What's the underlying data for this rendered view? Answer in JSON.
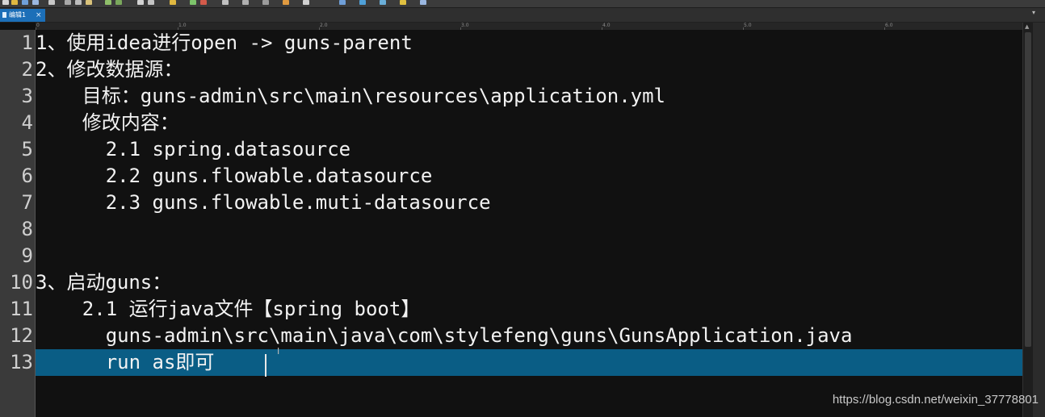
{
  "tab": {
    "title": "编辑1",
    "close": "×"
  },
  "tab_menu_arrow": "▾",
  "ruler": [
    "0",
    "1.0",
    "2.0",
    "3.0",
    "4.0",
    "5.0",
    "6.0"
  ],
  "lines": [
    {
      "no": "1",
      "text": "1、使用idea进行open -> guns-parent"
    },
    {
      "no": "2",
      "text": "2、修改数据源："
    },
    {
      "no": "3",
      "text": "    目标：guns-admin\\src\\main\\resources\\application.yml"
    },
    {
      "no": "4",
      "text": "    修改内容："
    },
    {
      "no": "5",
      "text": "      2.1 spring.datasource"
    },
    {
      "no": "6",
      "text": "      2.2 guns.flowable.datasource"
    },
    {
      "no": "7",
      "text": "      2.3 guns.flowable.muti-datasource"
    },
    {
      "no": "8",
      "text": ""
    },
    {
      "no": "9",
      "text": ""
    },
    {
      "no": "10",
      "text": "3、启动guns："
    },
    {
      "no": "11",
      "text": "    2.1 运行java文件【spring boot】"
    },
    {
      "no": "12",
      "text": "      guns-admin\\src\\main\\java\\com\\stylefeng\\guns\\GunsApplication.java"
    },
    {
      "no": "13",
      "text": "      run as即可"
    }
  ],
  "current_line": 13,
  "colors": {
    "current_line_bg": "#0a5d85",
    "tab_active_bg": "#1c6fb8"
  },
  "watermark": "https://blog.csdn.net/weixin_37778801"
}
